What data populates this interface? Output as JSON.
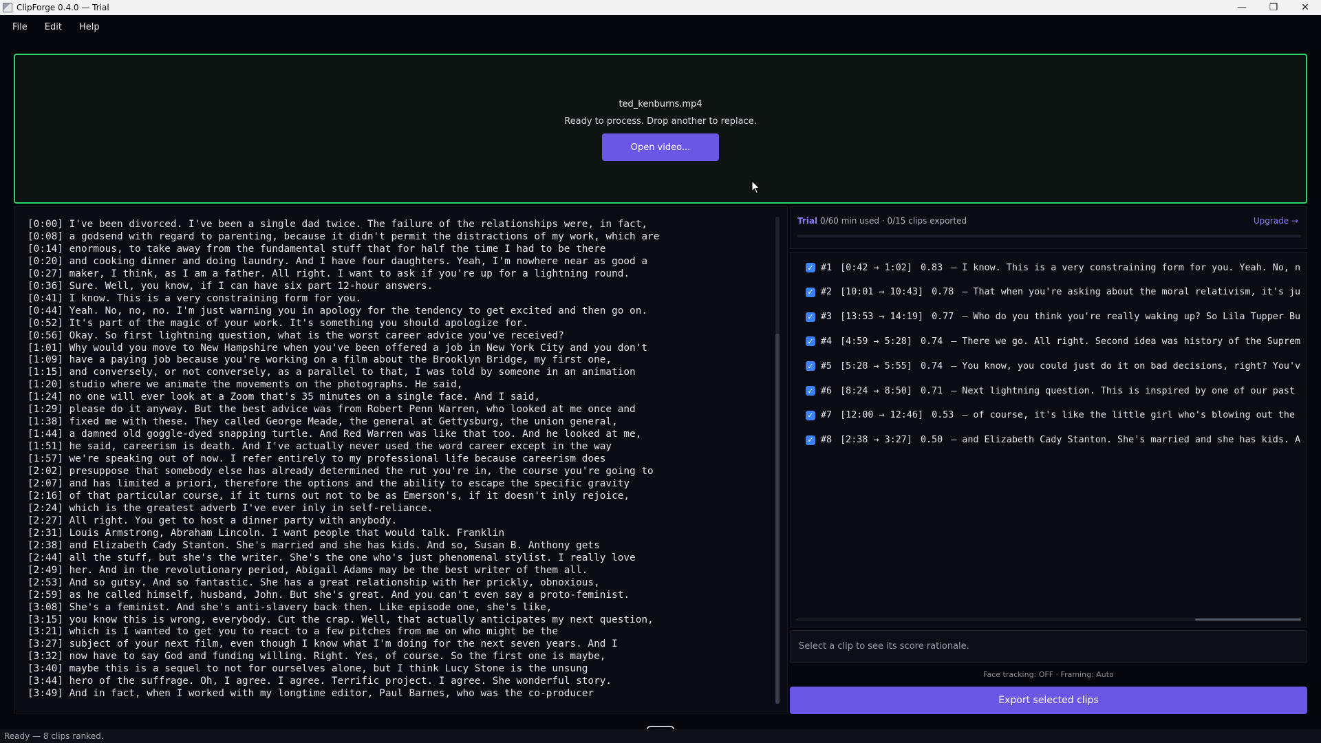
{
  "window": {
    "title": "ClipForge 0.4.0 — Trial",
    "controls": [
      "—",
      "❐",
      "✕"
    ]
  },
  "menu": [
    "File",
    "Edit",
    "Help"
  ],
  "dropzone": {
    "filename": "ted_kenburns.mp4",
    "status": "Ready to process. Drop another to replace.",
    "open_label": "Open video..."
  },
  "transcript": [
    "[0:00] I've been divorced. I've been a single dad twice. The failure of the relationships were, in fact,",
    "[0:08] a godsend with regard to parenting, because it didn't permit the distractions of my work, which are",
    "[0:14] enormous, to take away from the fundamental stuff that for half the time I had to be there",
    "[0:20] and cooking dinner and doing laundry. And I have four daughters. Yeah, I'm nowhere near as good a",
    "[0:27] maker, I think, as I am a father. All right. I want to ask if you're up for a lightning round.",
    "[0:36] Sure. Well, you know, if I can have six part 12-hour answers.",
    "[0:41] I know. This is a very constraining form for you.",
    "[0:44] Yeah. No, no, no. I'm just warning you in apology for the tendency to get excited and then go on.",
    "[0:52] It's part of the magic of your work. It's something you should apologize for.",
    "[0:56] Okay. So first lightning question, what is the worst career advice you've received?",
    "[1:01] Why would you move to New Hampshire when you've been offered a job in New York City and you don't",
    "[1:09] have a paying job because you're working on a film about the Brooklyn Bridge, my first one,",
    "[1:15] and conversely, or not conversely, as a parallel to that, I was told by someone in an animation",
    "[1:20] studio where we animate the movements on the photographs. He said,",
    "[1:24] no one will ever look at a Zoom that's 35 minutes on a single face. And I said,",
    "[1:29] please do it anyway. But the best advice was from Robert Penn Warren, who looked at me once and",
    "[1:38] fixed me with these. They called George Meade, the general at Gettysburg, the union general,",
    "[1:44] a damned old goggle-dyed snapping turtle. And Red Warren was like that too. And he looked at me,",
    "[1:51] he said, careerism is death. And I've actually never used the word career except in the way",
    "[1:57] we're speaking out of now. I refer entirely to my professional life because careerism does",
    "[2:02] presuppose that somebody else has already determined the rut you're in, the course you're going to",
    "[2:07] and has limited a priori, therefore the options and the ability to escape the specific gravity",
    "[2:16] of that particular course, if it turns out not to be as Emerson's, if it doesn't inly rejoice,",
    "[2:24] which is the greatest adverb I've ever inly in self-reliance.",
    "[2:27] All right. You get to host a dinner party with anybody.",
    "[2:31] Louis Armstrong, Abraham Lincoln. I want people that would talk. Franklin",
    "[2:38] and Elizabeth Cady Stanton. She's married and she has kids. And so, Susan B. Anthony gets",
    "[2:44] all the stuff, but she's the writer. She's the one who's just phenomenal stylist. I really love",
    "[2:49] her. And in the revolutionary period, Abigail Adams may be the best writer of them all.",
    "[2:53] And so gutsy. And so fantastic. She has a great relationship with her prickly, obnoxious,",
    "[2:59] as he called himself, husband, John. But she's great. And you can't even say a proto-feminist.",
    "[3:08] She's a feminist. And she's anti-slavery back then. Like episode one, she's like,",
    "[3:15] you know this is wrong, everybody. Cut the crap. Well, that actually anticipates my next question,",
    "[3:21] which is I wanted to get you to react to a few pitches from me on who might be the",
    "[3:27] subject of your next film, even though I know what I'm doing for the next seven years. And I",
    "[3:32] now have to say God and funding willing. Right. Yes, of course. So the first one is maybe,",
    "[3:40] maybe this is a sequel to not for ourselves alone, but I think Lucy Stone is the unsung",
    "[3:44] hero of the suffrage. Oh, I agree. I agree. Terrific project. I agree. She wonderful story.",
    "[3:49] And in fact, when I worked with my longtime editor, Paul Barnes, who was the co-producer"
  ],
  "trial": {
    "label": "Trial",
    "minutes_used": "0/60 min used",
    "separator": "·",
    "clips_exported": "0/15 clips exported",
    "upgrade_label": "Upgrade →",
    "usage_fraction": 0.0
  },
  "clips": [
    {
      "rank": "#1",
      "range": "[0:42 → 1:02]",
      "score": "0.83",
      "text": "– I know. This is a very constraining form for you. Yeah. No, n",
      "checked": true
    },
    {
      "rank": "#2",
      "range": "[10:01 → 10:43]",
      "score": "0.78",
      "text": "– That when you're asking about the moral relativism, it's ju",
      "checked": true
    },
    {
      "rank": "#3",
      "range": "[13:53 → 14:19]",
      "score": "0.77",
      "text": "– Who do you think you're really waking up? So Lila Tupper Bu",
      "checked": true
    },
    {
      "rank": "#4",
      "range": "[4:59 → 5:28]",
      "score": "0.74",
      "text": "– There we go. All right. Second idea was history of the Suprem",
      "checked": true
    },
    {
      "rank": "#5",
      "range": "[5:28 → 5:55]",
      "score": "0.74",
      "text": "– You know, you could just do it on bad decisions, right? You'v",
      "checked": true
    },
    {
      "rank": "#6",
      "range": "[8:24 → 8:50]",
      "score": "0.71",
      "text": "– Next lightning question. This is inspired by one of our past",
      "checked": true
    },
    {
      "rank": "#7",
      "range": "[12:00 → 12:46]",
      "score": "0.53",
      "text": "– of course, it's like the little girl who's blowing out the",
      "checked": true
    },
    {
      "rank": "#8",
      "range": "[2:38 → 3:27]",
      "score": "0.50",
      "text": "– and Elizabeth Cady Stanton. She's married and she has kids. A",
      "checked": true
    }
  ],
  "rationale_placeholder": "Select a clip to see its score rationale.",
  "face_tracking": "Face tracking: OFF · Framing: Auto",
  "export_label": "Export selected clips",
  "status": "Ready — 8 clips ranked.",
  "colors": {
    "accent": "#6b57e6",
    "dropzone_border": "#2bd66a",
    "checkbox": "#3b82f6",
    "trial_text": "#8b7cf6"
  }
}
